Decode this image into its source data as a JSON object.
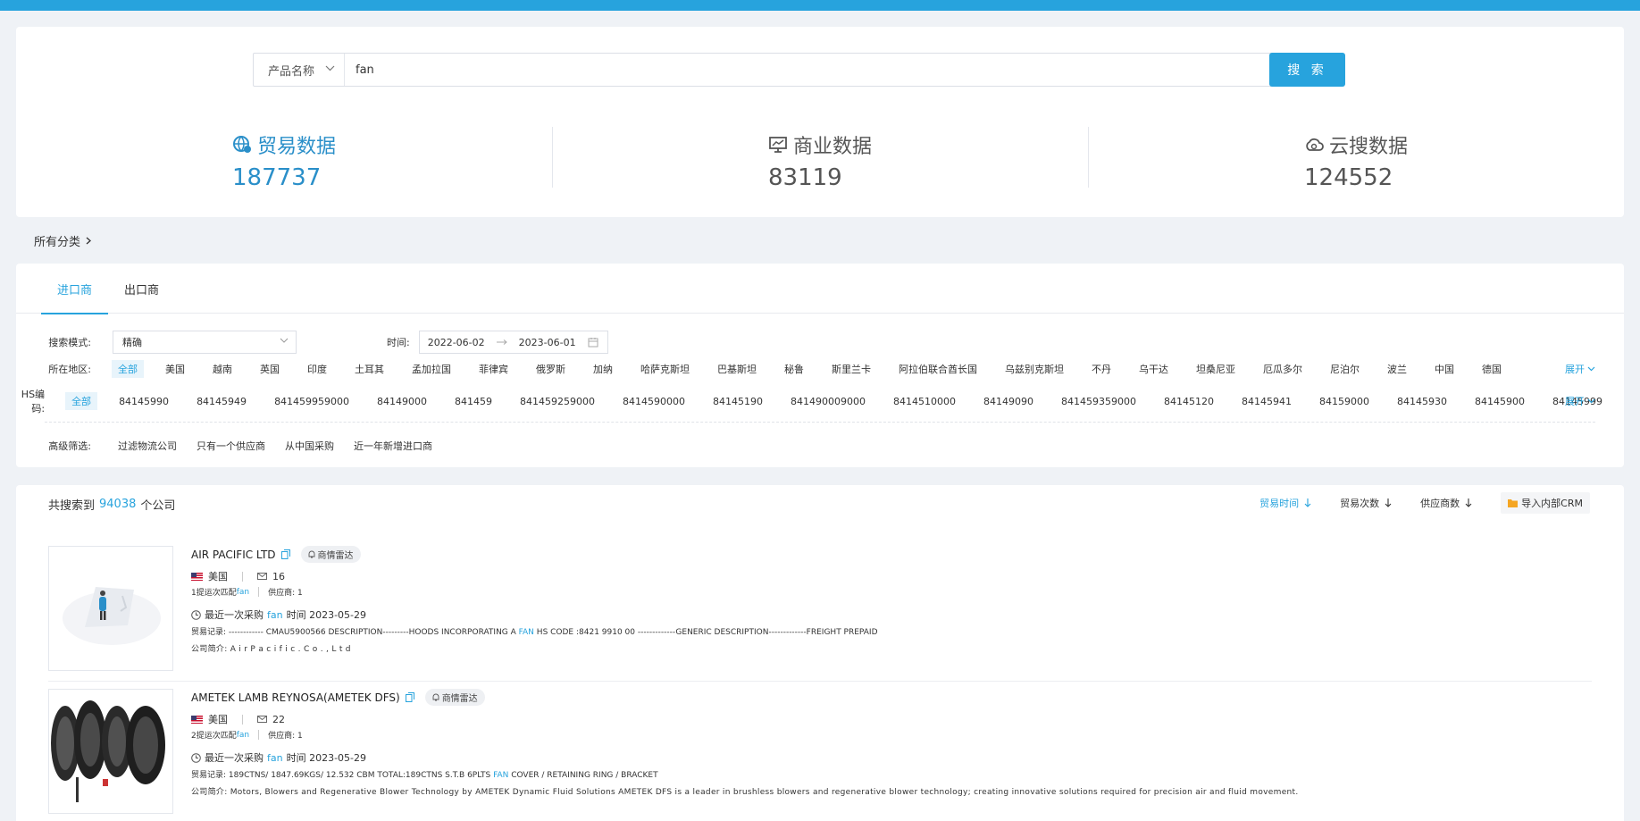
{
  "search": {
    "type_label": "产品名称",
    "query": "fan",
    "button_label": "搜 索"
  },
  "stats": [
    {
      "label": "贸易数据",
      "value": "187737",
      "icon": "globe-chat-icon"
    },
    {
      "label": "商业数据",
      "value": "83119",
      "icon": "monitor-chart-icon"
    },
    {
      "label": "云搜数据",
      "value": "124552",
      "icon": "cloud-search-icon"
    }
  ],
  "breadcrumb": {
    "label": "所有分类"
  },
  "tabs": [
    {
      "label": "进口商"
    },
    {
      "label": "出口商"
    }
  ],
  "filters": {
    "mode_label": "搜索模式:",
    "mode_value": "精确",
    "time_label": "时间:",
    "date_start": "2022-06-02",
    "date_end": "2023-06-01",
    "region_label": "所在地区:",
    "regions": [
      "全部",
      "美国",
      "越南",
      "英国",
      "印度",
      "土耳其",
      "孟加拉国",
      "菲律宾",
      "俄罗斯",
      "加纳",
      "哈萨克斯坦",
      "巴基斯坦",
      "秘鲁",
      "斯里兰卡",
      "阿拉伯联合酋长国",
      "乌兹别克斯坦",
      "不丹",
      "乌干达",
      "坦桑尼亚",
      "厄瓜多尔",
      "尼泊尔",
      "波兰",
      "中国",
      "德国"
    ],
    "hs_label": "HS编码:",
    "hs_codes": [
      "全部",
      "84145990",
      "84145949",
      "841459959000",
      "84149000",
      "841459",
      "841459259000",
      "8414590000",
      "84145190",
      "841490009000",
      "8414510000",
      "84149090",
      "841459359000",
      "84145120",
      "84145941",
      "84159000",
      "84145930",
      "84145900",
      "84145999"
    ],
    "expand_label": "展开",
    "advanced_label": "高级筛选:",
    "advanced": [
      "过滤物流公司",
      "只有一个供应商",
      "从中国采购",
      "近一年新增进口商"
    ]
  },
  "results": {
    "prefix": "共搜索到",
    "count": "94038",
    "suffix": "个公司",
    "sorts": [
      {
        "label": "贸易时间"
      },
      {
        "label": "贸易次数"
      },
      {
        "label": "供应商数"
      }
    ],
    "crm_label": "导入内部CRM"
  },
  "companies": [
    {
      "name": "AIR PACIFIC LTD",
      "radar": "商情雷达",
      "country": "美国",
      "emails": "16",
      "match_prefix": "1提运次匹配",
      "match_kw": "fan",
      "suppliers": "供应商: 1",
      "last_prefix": "最近一次采购",
      "last_kw": "fan",
      "last_time": "时间 2023-05-29",
      "trade_prefix": "贸易记录: ------------ CMAU5900566 DESCRIPTION---------HOODS INCORPORATING A",
      "trade_kw": "FAN",
      "trade_suffix": "HS CODE :8421 9910 00 -------------GENERIC DESCRIPTION-------------FREIGHT PREPAID",
      "intro": "公司简介: A i r P a c i f i c . C o . , L t d"
    },
    {
      "name": "AMETEK LAMB REYNOSA(AMETEK DFS)",
      "radar": "商情雷达",
      "country": "美国",
      "emails": "22",
      "match_prefix": "2提运次匹配",
      "match_kw": "fan",
      "suppliers": "供应商: 1",
      "last_prefix": "最近一次采购",
      "last_kw": "fan",
      "last_time": "时间 2023-05-29",
      "trade_prefix": "贸易记录: 189CTNS/ 1847.69KGS/ 12.532 CBM TOTAL:189CTNS S.T.B 6PLTS",
      "trade_kw": "FAN",
      "trade_suffix": "COVER / RETAINING RING / BRACKET",
      "intro": "公司简介: Motors, Blowers and Regenerative Blower Technology by AMETEK Dynamic Fluid Solutions AMETEK DFS is a leader in brushless blowers and regenerative blower technology; creating innovative solutions required for precision air and fluid movement."
    }
  ],
  "colors": {
    "accent": "#27a3dd",
    "background": "#eff2f6"
  }
}
